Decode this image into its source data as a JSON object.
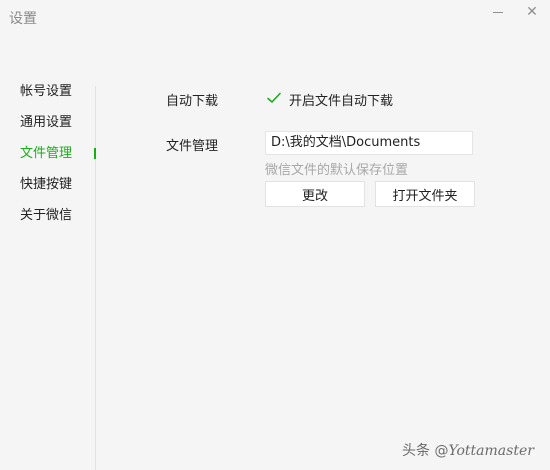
{
  "window": {
    "title": "设置"
  },
  "sidebar": {
    "items": [
      {
        "label": "帐号设置",
        "active": false
      },
      {
        "label": "通用设置",
        "active": false
      },
      {
        "label": "文件管理",
        "active": true
      },
      {
        "label": "快捷按键",
        "active": false
      },
      {
        "label": "关于微信",
        "active": false
      }
    ]
  },
  "file_management": {
    "auto_download_label": "自动下载",
    "auto_download_checkbox_label": "开启文件自动下载",
    "auto_download_checked": true,
    "file_management_label": "文件管理",
    "save_path": "D:\\我的文档\\Documents",
    "save_path_hint": "微信文件的默认保存位置",
    "change_button": "更改",
    "open_folder_button": "打开文件夹"
  },
  "watermark": {
    "prefix": "头条 @",
    "brand": "Yottamaster"
  },
  "colors": {
    "accent": "#1aad19",
    "background": "#f5f5f5",
    "hint_text": "#a8a8a8"
  }
}
